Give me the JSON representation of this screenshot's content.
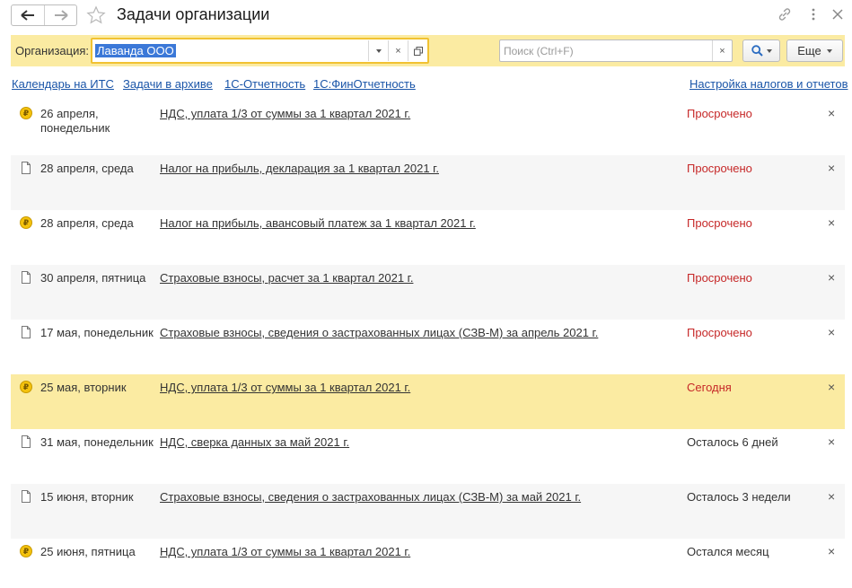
{
  "window": {
    "title": "Задачи организации",
    "icons": [
      "arrow-left-icon",
      "arrow-right-icon",
      "star-icon",
      "link-icon",
      "more-vertical-icon",
      "close-icon"
    ]
  },
  "filter": {
    "org_label": "Организация:",
    "org_value": "Лаванда ООО",
    "search_placeholder": "Поиск (Ctrl+F)",
    "more_label": "Еще",
    "accent_color": "#fbeba2"
  },
  "links": [
    {
      "label": "Календарь на ИТС"
    },
    {
      "label": "Задачи в архиве"
    },
    {
      "label": "1С-Отчетность"
    },
    {
      "label": "1С:ФинОтчетность"
    },
    {
      "label": "Настройка налогов и отчетов"
    }
  ],
  "tasks": [
    {
      "icon": "ruble-coin-icon",
      "date": "26 апреля, понедельник",
      "name": "НДС, уплата 1/3 от суммы за 1 квартал 2021 г.",
      "status": "Просрочено",
      "state": "overdue"
    },
    {
      "icon": "document-icon",
      "date": "28 апреля, среда",
      "name": "Налог на прибыль, декларация за 1 квартал 2021 г.",
      "status": "Просрочено",
      "state": "overdue"
    },
    {
      "icon": "ruble-coin-icon",
      "date": "28 апреля, среда",
      "name": "Налог на прибыль, авансовый платеж за 1 квартал 2021 г.",
      "status": "Просрочено",
      "state": "overdue"
    },
    {
      "icon": "document-icon",
      "date": "30 апреля, пятница",
      "name": "Страховые взносы, расчет за 1 квартал 2021 г.",
      "status": "Просрочено",
      "state": "overdue"
    },
    {
      "icon": "document-icon",
      "date": "17 мая, понедельник",
      "name": "Страховые взносы, сведения о застрахованных лицах (СЗВ-М) за апрель 2021 г.",
      "status": "Просрочено",
      "state": "overdue"
    },
    {
      "icon": "ruble-coin-icon",
      "date": "25 мая, вторник",
      "name": "НДС, уплата 1/3 от суммы за 1 квартал 2021 г.",
      "status": "Сегодня",
      "state": "today"
    },
    {
      "icon": "document-icon",
      "date": "31 мая, понедельник",
      "name": "НДС, сверка данных за май 2021 г.",
      "status": "Осталось 6 дней",
      "state": "normal"
    },
    {
      "icon": "document-icon",
      "date": "15 июня, вторник",
      "name": "Страховые взносы, сведения о застрахованных лицах (СЗВ-М) за май 2021 г.",
      "status": "Осталось 3 недели",
      "state": "normal"
    },
    {
      "icon": "ruble-coin-icon",
      "date": "25 июня, пятница",
      "name": "НДС, уплата 1/3 от суммы за 1 квартал 2021 г.",
      "status": "Остался месяц",
      "state": "normal"
    }
  ],
  "coin_glyph": "₽",
  "remove_glyph": "×"
}
